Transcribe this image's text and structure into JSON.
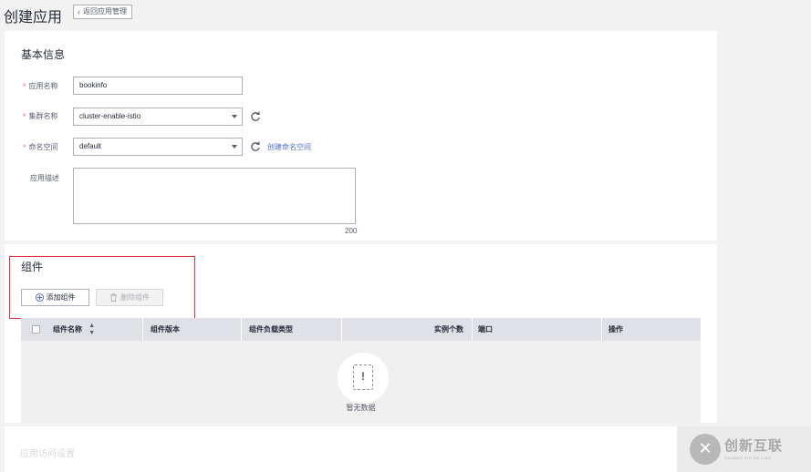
{
  "header": {
    "title": "创建应用",
    "back_label": "返回应用管理"
  },
  "basic_info": {
    "section_title": "基本信息",
    "app_name": {
      "label": "应用名称",
      "value": "bookinfo"
    },
    "cluster": {
      "label": "集群名称",
      "value": "cluster-enable-istio"
    },
    "namespace": {
      "label": "命名空间",
      "value": "default",
      "create_link": "创建命名空间"
    },
    "description": {
      "label": "应用描述",
      "value": "",
      "remaining": "200"
    }
  },
  "components": {
    "section_title": "组件",
    "add_button": "添加组件",
    "delete_button": "删除组件",
    "table": {
      "columns": [
        "组件名称",
        "组件版本",
        "组件负载类型",
        "实例个数",
        "端口",
        "操作"
      ],
      "empty_text": "暂无数据"
    }
  },
  "access_settings": {
    "section_title": "应用访问设置"
  },
  "watermark": {
    "title": "创新互联",
    "subtitle": "CHUANG XIN HU LIAN",
    "logo_glyph": "✕"
  },
  "colors": {
    "accent": "#526ecc",
    "required": "#f66f6a",
    "highlight_box": "#e5323a"
  }
}
